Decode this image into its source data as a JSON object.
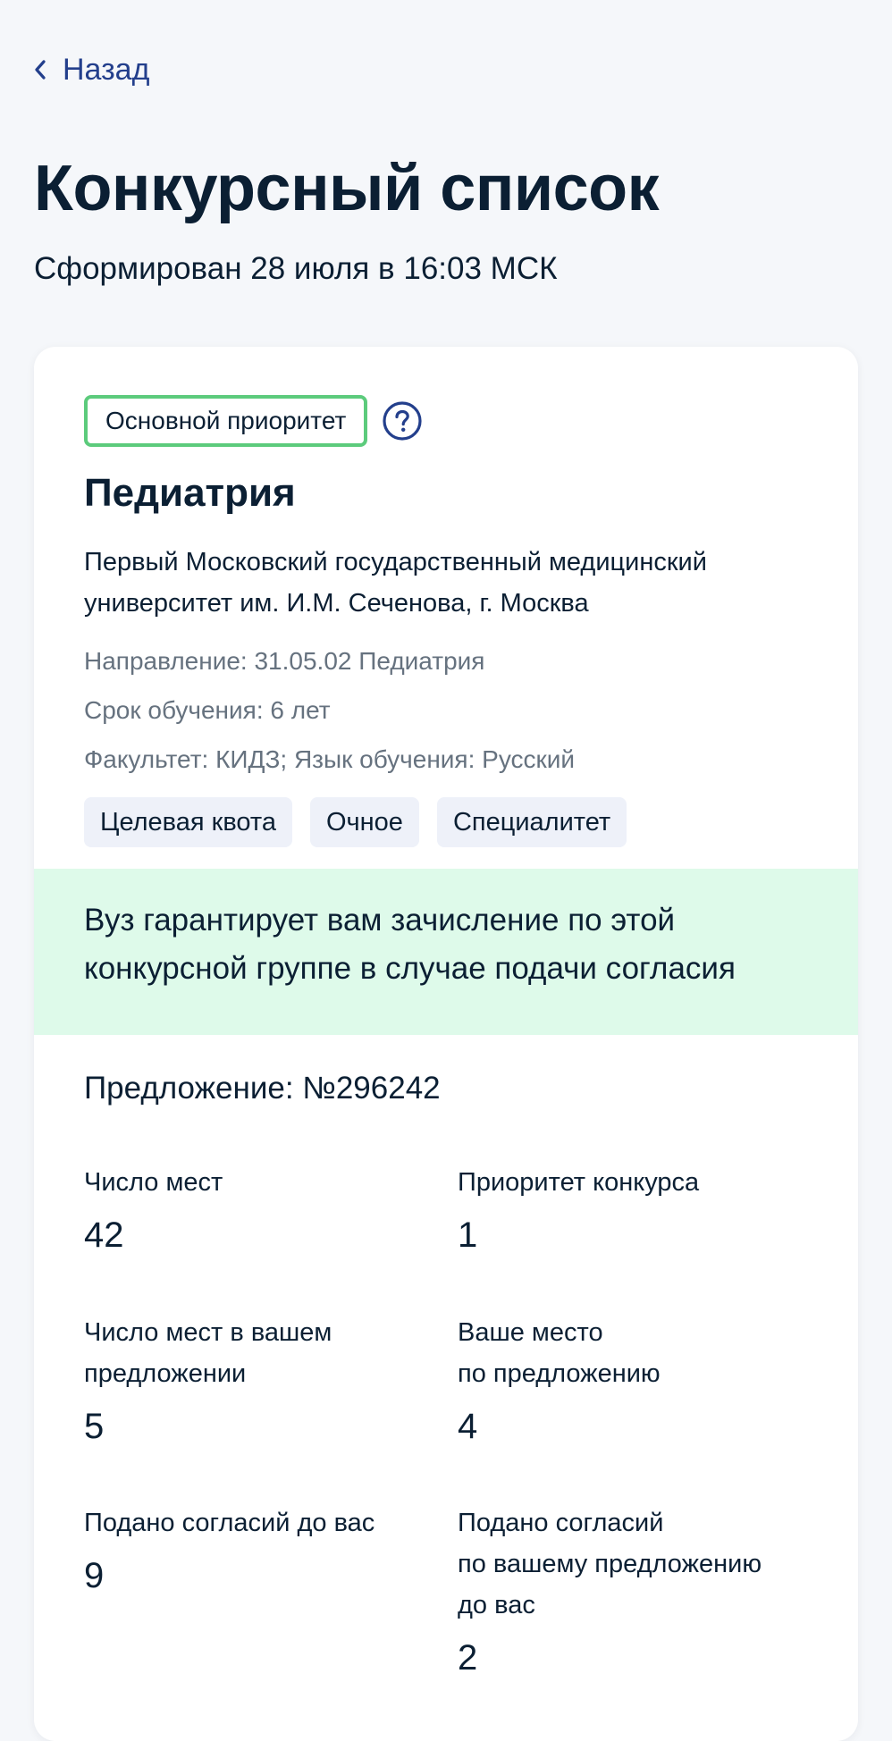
{
  "nav": {
    "back_label": "Назад"
  },
  "header": {
    "title": "Конкурсный список",
    "subtitle": "Сформирован 28 июля в 16:03 МСК"
  },
  "card": {
    "priority_badge": "Основной приоритет",
    "help_icon": "question-circle-icon",
    "program": "Педиатрия",
    "university_line1": "Первый Московский государственный медицинский",
    "university_line2": "университет им. И.М. Сеченова, г. Москва",
    "direction": "Направление: 31.05.02 Педиатрия",
    "duration": "Срок обучения: 6 лет",
    "faculty": "Факультет: КИДЗ; Язык обучения: Русский",
    "tags": [
      "Целевая квота",
      "Очное",
      "Специалитет"
    ],
    "guarantee_line1": "Вуз гарантирует вам зачисление по этой",
    "guarantee_line2": "конкурсной группе в случае подачи согласия",
    "offer": "Предложение: №296242",
    "stats": {
      "seats": {
        "label": "Число мест",
        "value": "42"
      },
      "competition_priority": {
        "label": "Приоритет конкурса",
        "value": "1"
      },
      "seats_in_offer": {
        "label_line1": "Число мест в вашем",
        "label_line2": "предложении",
        "value": "5"
      },
      "your_place": {
        "label_line1": "Ваше место",
        "label_line2": "по предложению",
        "value": "4"
      },
      "consents_before": {
        "label": "Подано согласий до вас",
        "value": "9"
      },
      "consents_offer_before": {
        "label_line1": "Подано согласий",
        "label_line2": "по вашему предложению",
        "label_line3": "до вас",
        "value": "2"
      }
    }
  },
  "colors": {
    "background": "#f5f7fa",
    "link": "#233f8c",
    "badge_border": "#5ccb7c",
    "banner": "#defaea",
    "tag_bg": "#eef1f9",
    "muted_text": "#66727f"
  }
}
